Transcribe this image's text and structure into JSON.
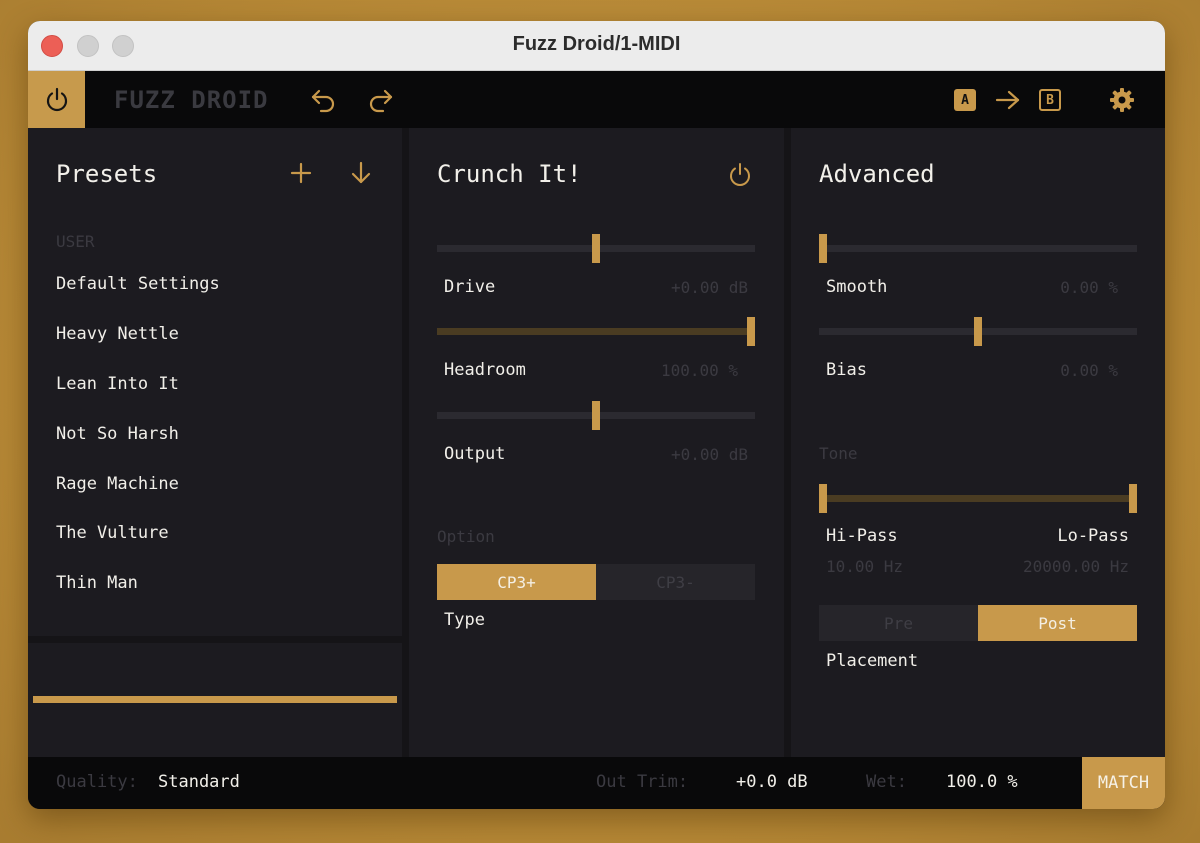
{
  "window": {
    "title": "Fuzz Droid/1-MIDI"
  },
  "topbar": {
    "brand": "FUZZ DROID",
    "ab": {
      "a_label": "A",
      "b_label": "B"
    }
  },
  "presets": {
    "title": "Presets",
    "group_label": "USER",
    "items": [
      "Default Settings",
      "Heavy Nettle",
      "Lean Into It",
      "Not So Harsh",
      "Rage Machine",
      "The Vulture",
      "Thin Man"
    ]
  },
  "crunch": {
    "title": "Crunch It!",
    "drive": {
      "label": "Drive",
      "value": "+0.00 dB",
      "level": 0.5
    },
    "headroom": {
      "label": "Headroom",
      "value": "100.00 %",
      "level": 1.0
    },
    "output": {
      "label": "Output",
      "value": "+0.00 dB",
      "level": 0.5
    },
    "option_label": "Option",
    "type": {
      "label": "Type",
      "options": [
        "CP3+",
        "CP3-"
      ],
      "selected": "CP3+"
    }
  },
  "advanced": {
    "title": "Advanced",
    "smooth": {
      "label": "Smooth",
      "value": "0.00 %",
      "level": 0.0
    },
    "bias": {
      "label": "Bias",
      "value": "0.00 %",
      "level": 0.5
    },
    "tone": {
      "label": "Tone",
      "hipass_label": "Hi-Pass",
      "hipass_value": "10.00 Hz",
      "lopass_label": "Lo-Pass",
      "lopass_value": "20000.00 Hz",
      "range": [
        0.0,
        1.0
      ]
    },
    "placement": {
      "label": "Placement",
      "options": [
        "Pre",
        "Post"
      ],
      "selected": "Post"
    }
  },
  "status": {
    "quality_label": "Quality:",
    "quality_value": "Standard",
    "outtrim_label": "Out Trim:",
    "outtrim_value": "+0.0 dB",
    "wet_label": "Wet:",
    "wet_value": "100.0 %",
    "match_label": "MATCH"
  },
  "colors": {
    "accent": "#c8994b",
    "panel": "#1c1b20",
    "muted_text": "#3b3a41"
  },
  "icons": [
    "power-icon",
    "undo-icon",
    "redo-icon",
    "arrow-right-icon",
    "gear-icon",
    "plus-icon",
    "download-arrow-icon"
  ]
}
